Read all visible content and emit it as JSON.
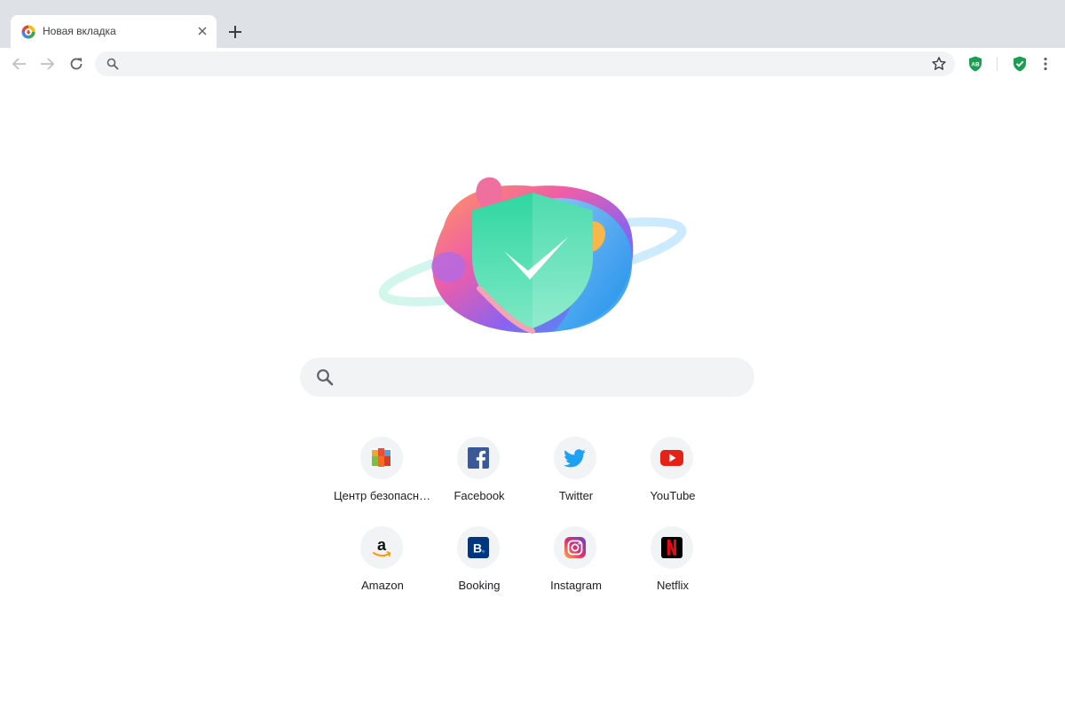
{
  "tab": {
    "title": "Новая вкладка"
  },
  "omnibox": {
    "value": "",
    "placeholder": ""
  },
  "extensions": [
    {
      "name": "adblock-extension",
      "label": "AB",
      "color": "#1a9e52"
    },
    {
      "name": "security-extension",
      "label": "",
      "color": "#1a9e52"
    }
  ],
  "search": {
    "value": "",
    "placeholder": ""
  },
  "shortcuts": [
    {
      "label": "Центр безопасности",
      "icon": "avg-icon"
    },
    {
      "label": "Facebook",
      "icon": "facebook-icon"
    },
    {
      "label": "Twitter",
      "icon": "twitter-icon"
    },
    {
      "label": "YouTube",
      "icon": "youtube-icon"
    },
    {
      "label": "Amazon",
      "icon": "amazon-icon"
    },
    {
      "label": "Booking",
      "icon": "booking-icon"
    },
    {
      "label": "Instagram",
      "icon": "instagram-icon"
    },
    {
      "label": "Netflix",
      "icon": "netflix-icon"
    }
  ],
  "colors": {
    "tabstrip": "#dee1e6",
    "omnibox": "#f1f3f4",
    "accent_green": "#1a9e52"
  }
}
